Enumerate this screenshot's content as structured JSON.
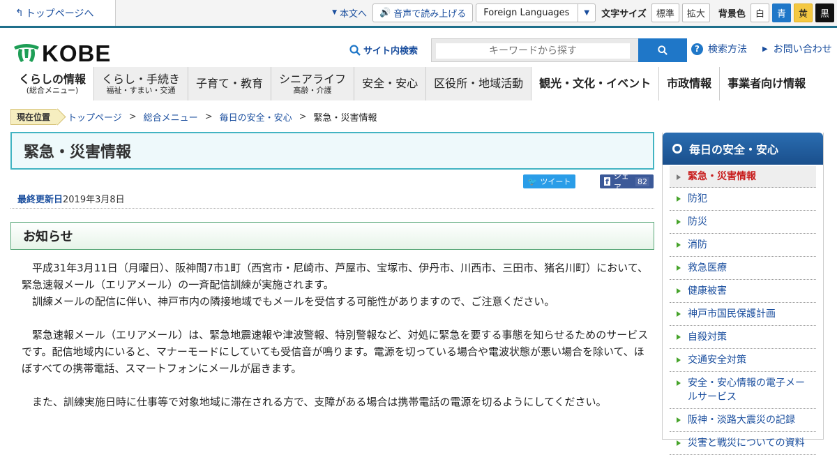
{
  "utility": {
    "home_link": "トップページへ",
    "skip_link": "本文へ",
    "read_aloud": "音声で読み上げる",
    "language": "Foreign Languages",
    "font_size_label": "文字サイズ",
    "font_standard": "標準",
    "font_large": "拡大",
    "bgcolor_label": "背景色",
    "bg_white": "白",
    "bg_blue": "青",
    "bg_yellow": "黄",
    "bg_black": "黒"
  },
  "header": {
    "logo_text": "KOBE",
    "search_label": "サイト内検索",
    "search_placeholder": "キーワードから探す",
    "search_method": "検索方法",
    "contact": "お問い合わせ"
  },
  "gnav": [
    {
      "main": "くらしの情報",
      "sub": "(総合メニュー)"
    },
    {
      "main": "くらし・手続き",
      "sub": "福祉・すまい・交通"
    },
    {
      "main": "子育て・教育",
      "sub": ""
    },
    {
      "main": "シニアライフ",
      "sub": "高齢・介護"
    },
    {
      "main": "安全・安心",
      "sub": ""
    },
    {
      "main": "区役所・地域活動",
      "sub": ""
    },
    {
      "main": "観光・文化・イベント",
      "sub": ""
    },
    {
      "main": "市政情報",
      "sub": ""
    },
    {
      "main": "事業者向け情報",
      "sub": ""
    }
  ],
  "breadcrumb": {
    "label": "現在位置",
    "items": [
      "トップページ",
      "総合メニュー",
      "毎日の安全・安心"
    ],
    "current": "緊急・災害情報",
    "sep": ">"
  },
  "page": {
    "title": "緊急・災害情報",
    "tweet": "ツイート",
    "share": "シェア",
    "share_count": "82",
    "updated_label": "最終更新日",
    "updated_date": "2019年3月8日",
    "section_heading": "お知らせ",
    "paragraphs": [
      "平成31年3月11日（月曜日）、阪神間7市1町（西宮市・尼崎市、芦屋市、宝塚市、伊丹市、川西市、三田市、猪名川町）において、緊急速報メール（エリアメール）の一斉配信訓練が実施されます。",
      "訓練メールの配信に伴い、神戸市内の隣接地域でもメールを受信する可能性がありますので、ご注意ください。",
      "緊急速報メール（エリアメール）は、緊急地震速報や津波警報、特別警報など、対処に緊急を要する事態を知らせるためのサービスです。配信地域内にいると、マナーモードにしていても受信音が鳴ります。電源を切っている場合や電波状態が悪い場合を除いて、ほぼすべての携帯電話、スマートフォンにメールが届きます。",
      "また、訓練実施日時に仕事等で対象地域に滞在される方で、支障がある場合は携帯電話の電源を切るようにしてください。"
    ]
  },
  "sidebar": {
    "heading": "毎日の安全・安心",
    "current": "緊急・災害情報",
    "items": [
      "防犯",
      "防災",
      "消防",
      "救急医療",
      "健康被害",
      "神戸市国民保護計画",
      "自殺対策",
      "交通安全対策",
      "安全・安心情報の電子メールサービス",
      "阪神・淡路大震災の記録",
      "災害と戦災についての資料"
    ]
  }
}
